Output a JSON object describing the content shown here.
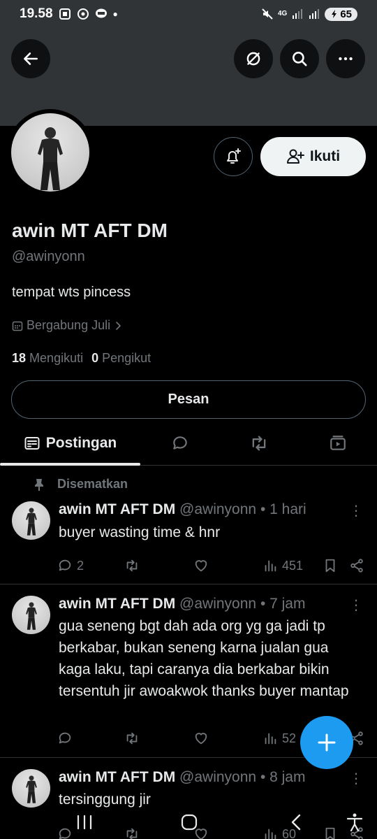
{
  "status_bar": {
    "time": "19.58",
    "network": "4G",
    "battery": "65"
  },
  "toolbar": {
    "back_icon": "arrow-left-icon",
    "hide_icon": "eye-off-icon",
    "search_icon": "search-icon",
    "more_icon": "more-horizontal-icon"
  },
  "profile": {
    "display_name": "awin MT AFT DM",
    "handle": "@awinyonn",
    "bio": "tempat wts pincess",
    "joined": "Bergabung Juli",
    "following_count": "18",
    "following_label": "Mengikuti",
    "followers_count": "0",
    "followers_label": "Pengikut",
    "follow_label": "Ikuti",
    "message_label": "Pesan"
  },
  "tabs": [
    {
      "label": "Postingan",
      "icon": "post-list-icon",
      "active": true
    },
    {
      "label": "",
      "icon": "reply-bubble-icon",
      "active": false
    },
    {
      "label": "",
      "icon": "retweet-icon",
      "active": false
    },
    {
      "label": "",
      "icon": "media-icon",
      "active": false
    }
  ],
  "pinned_label": "Disematkan",
  "posts": [
    {
      "name": "awin MT AFT DM",
      "handle": "@awinyonn",
      "time": "• 1 hari",
      "text": "buyer wasting time & hnr",
      "replies": "2",
      "retweets": "",
      "likes": "",
      "views": "451"
    },
    {
      "name": "awin MT AFT DM",
      "handle": "@awinyonn",
      "time": "• 7 jam",
      "text": "gua seneng bgt dah ada org yg ga jadi tp berkabar, bukan seneng karna jualan gua kaga laku, tapi caranya dia berkabar bikin tersentuh jir awoakwok thanks buyer mantap",
      "replies": "",
      "retweets": "",
      "likes": "",
      "views": "52"
    },
    {
      "name": "awin MT AFT DM",
      "handle": "@awinyonn",
      "time": "• 8 jam",
      "text": "tersinggung jir",
      "replies": "",
      "retweets": "",
      "likes": "",
      "views": "60"
    }
  ],
  "colors": {
    "accent": "#1d9bf0",
    "muted": "#71767b",
    "background": "#000000",
    "banner": "#313436"
  }
}
